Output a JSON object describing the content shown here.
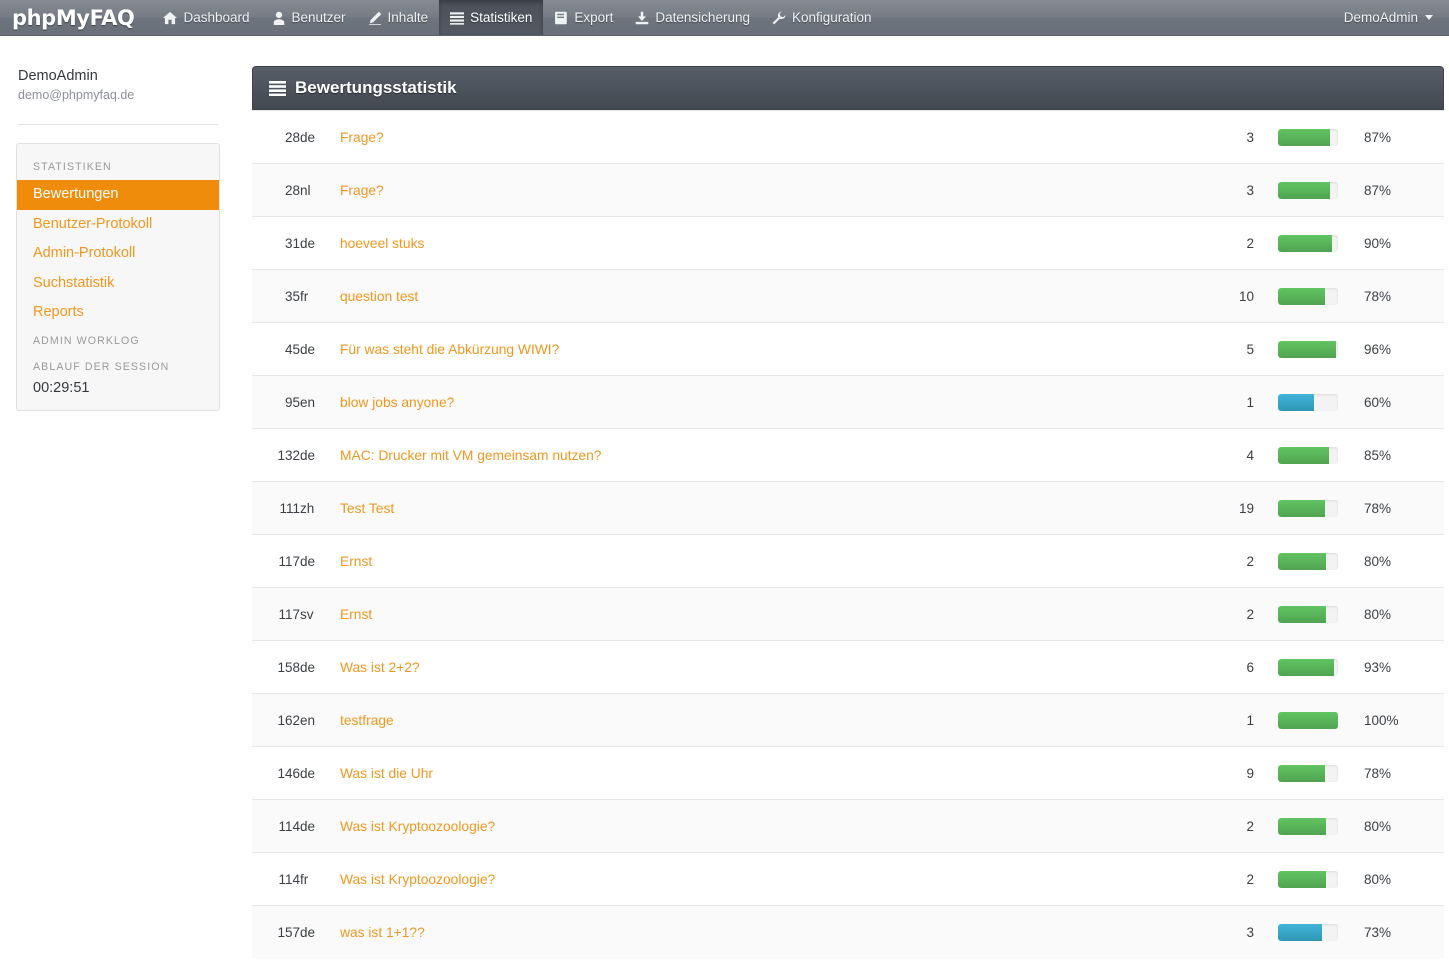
{
  "navbar": {
    "brand": "phpMyFAQ",
    "items": [
      {
        "label": "Dashboard",
        "icon": "home-icon",
        "active": false
      },
      {
        "label": "Benutzer",
        "icon": "user-icon",
        "active": false
      },
      {
        "label": "Inhalte",
        "icon": "pencil-icon",
        "active": false
      },
      {
        "label": "Statistiken",
        "icon": "bars-icon",
        "active": true
      },
      {
        "label": "Export",
        "icon": "book-icon",
        "active": false
      },
      {
        "label": "Datensicherung",
        "icon": "download-icon",
        "active": false
      },
      {
        "label": "Konfiguration",
        "icon": "wrench-icon",
        "active": false
      }
    ],
    "user_label": "DemoAdmin"
  },
  "sidebar": {
    "user_name": "DemoAdmin",
    "user_email": "demo@phpmyfaq.de",
    "section_statistics_label": "STATISTIKEN",
    "links": [
      {
        "label": "Bewertungen",
        "active": true
      },
      {
        "label": "Benutzer-Protokoll",
        "active": false
      },
      {
        "label": "Admin-Protokoll",
        "active": false
      },
      {
        "label": "Suchstatistik",
        "active": false
      },
      {
        "label": "Reports",
        "active": false
      }
    ],
    "section_worklog_label": "ADMIN WORKLOG",
    "section_session_label": "ABLAUF DER SESSION",
    "session_time": "00:29:51"
  },
  "panel": {
    "title": "Bewertungsstatistik",
    "icon": "align-justify-icon"
  },
  "colors": {
    "accent_orange": "#f0971e",
    "active_orange": "#f08c0c",
    "bar_green": "#51a351",
    "bar_blue": "#2f96b4",
    "navbar_gray": "#767c85",
    "panel_header": "#4c525b"
  },
  "table": {
    "rows": [
      {
        "id": "28",
        "lang": "de",
        "question": "Frage?",
        "votes": "3",
        "bar_color": "green",
        "percent": "87%",
        "percent_value": 87
      },
      {
        "id": "28",
        "lang": "nl",
        "question": "Frage?",
        "votes": "3",
        "bar_color": "green",
        "percent": "87%",
        "percent_value": 87
      },
      {
        "id": "31",
        "lang": "de",
        "question": "hoeveel stuks",
        "votes": "2",
        "bar_color": "green",
        "percent": "90%",
        "percent_value": 90
      },
      {
        "id": "35",
        "lang": "fr",
        "question": "question test",
        "votes": "10",
        "bar_color": "green",
        "percent": "78%",
        "percent_value": 78
      },
      {
        "id": "45",
        "lang": "de",
        "question": "Für was steht die Abkürzung WIWI?",
        "votes": "5",
        "bar_color": "green",
        "percent": "96%",
        "percent_value": 96
      },
      {
        "id": "95",
        "lang": "en",
        "question": "blow jobs anyone?",
        "votes": "1",
        "bar_color": "blue",
        "percent": "60%",
        "percent_value": 60
      },
      {
        "id": "132",
        "lang": "de",
        "question": "MAC: Drucker mit VM gemeinsam nutzen?",
        "votes": "4",
        "bar_color": "green",
        "percent": "85%",
        "percent_value": 85
      },
      {
        "id": "111",
        "lang": "zh",
        "question": "Test Test",
        "votes": "19",
        "bar_color": "green",
        "percent": "78%",
        "percent_value": 78
      },
      {
        "id": "117",
        "lang": "de",
        "question": "Ernst",
        "votes": "2",
        "bar_color": "green",
        "percent": "80%",
        "percent_value": 80
      },
      {
        "id": "117",
        "lang": "sv",
        "question": "Ernst",
        "votes": "2",
        "bar_color": "green",
        "percent": "80%",
        "percent_value": 80
      },
      {
        "id": "158",
        "lang": "de",
        "question": "Was ist 2+2?",
        "votes": "6",
        "bar_color": "green",
        "percent": "93%",
        "percent_value": 93
      },
      {
        "id": "162",
        "lang": "en",
        "question": "testfrage",
        "votes": "1",
        "bar_color": "green",
        "percent": "100%",
        "percent_value": 100
      },
      {
        "id": "146",
        "lang": "de",
        "question": "Was ist die Uhr",
        "votes": "9",
        "bar_color": "green",
        "percent": "78%",
        "percent_value": 78
      },
      {
        "id": "114",
        "lang": "de",
        "question": "Was ist Kryptoozoologie?",
        "votes": "2",
        "bar_color": "green",
        "percent": "80%",
        "percent_value": 80
      },
      {
        "id": "114",
        "lang": "fr",
        "question": "Was ist Kryptoozoologie?",
        "votes": "2",
        "bar_color": "green",
        "percent": "80%",
        "percent_value": 80
      },
      {
        "id": "157",
        "lang": "de",
        "question": "was ist 1+1??",
        "votes": "3",
        "bar_color": "blue",
        "percent": "73%",
        "percent_value": 73
      }
    ]
  }
}
